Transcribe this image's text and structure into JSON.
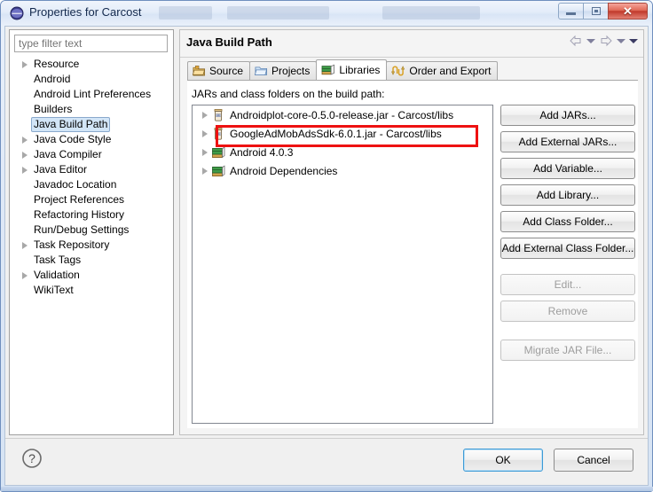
{
  "window": {
    "title": "Properties for Carcost",
    "icon": "eclipse-icon",
    "controls": {
      "minimize": "minimize",
      "restore": "restore",
      "close": "close"
    }
  },
  "sidebar": {
    "filter_placeholder": "type filter text",
    "items": [
      {
        "label": "Resource",
        "expandable": true,
        "selected": false
      },
      {
        "label": "Android",
        "expandable": false,
        "selected": false
      },
      {
        "label": "Android Lint Preferences",
        "expandable": false,
        "selected": false
      },
      {
        "label": "Builders",
        "expandable": false,
        "selected": false
      },
      {
        "label": "Java Build Path",
        "expandable": false,
        "selected": true
      },
      {
        "label": "Java Code Style",
        "expandable": true,
        "selected": false
      },
      {
        "label": "Java Compiler",
        "expandable": true,
        "selected": false
      },
      {
        "label": "Java Editor",
        "expandable": true,
        "selected": false
      },
      {
        "label": "Javadoc Location",
        "expandable": false,
        "selected": false
      },
      {
        "label": "Project References",
        "expandable": false,
        "selected": false
      },
      {
        "label": "Refactoring History",
        "expandable": false,
        "selected": false
      },
      {
        "label": "Run/Debug Settings",
        "expandable": false,
        "selected": false
      },
      {
        "label": "Task Repository",
        "expandable": true,
        "selected": false
      },
      {
        "label": "Task Tags",
        "expandable": false,
        "selected": false
      },
      {
        "label": "Validation",
        "expandable": true,
        "selected": false
      },
      {
        "label": "WikiText",
        "expandable": false,
        "selected": false
      }
    ]
  },
  "page": {
    "title": "Java Build Path",
    "nav": {
      "back": "back-arrow",
      "back_menu": "chevron-down",
      "forward": "forward-arrow",
      "forward_menu": "chevron-down",
      "menu": "chevron-down"
    },
    "tabs": [
      {
        "label": "Source",
        "icon": "source-folder-icon",
        "active": false
      },
      {
        "label": "Projects",
        "icon": "open-folder-icon",
        "active": false
      },
      {
        "label": "Libraries",
        "icon": "libraries-books-icon",
        "active": true
      },
      {
        "label": "Order and Export",
        "icon": "order-export-icon",
        "active": false
      }
    ],
    "list_label": "JARs and class folders on the build path:",
    "entries": [
      {
        "label": "Androidplot-core-0.5.0-release.jar - Carcost/libs",
        "icon": "jar-icon",
        "highlighted": false
      },
      {
        "label": "GoogleAdMobAdsSdk-6.0.1.jar - Carcost/libs",
        "icon": "jar-icon",
        "highlighted": true
      },
      {
        "label": "Android 4.0.3",
        "icon": "library-icon",
        "highlighted": false
      },
      {
        "label": "Android Dependencies",
        "icon": "library-icon",
        "highlighted": false
      }
    ],
    "highlight_color": "#ee1111",
    "buttons": [
      {
        "label": "Add JARs...",
        "enabled": true
      },
      {
        "label": "Add External JARs...",
        "enabled": true
      },
      {
        "label": "Add Variable...",
        "enabled": true
      },
      {
        "label": "Add Library...",
        "enabled": true
      },
      {
        "label": "Add Class Folder...",
        "enabled": true
      },
      {
        "label": "Add External Class Folder...",
        "enabled": true
      },
      {
        "label": "Edit...",
        "enabled": false
      },
      {
        "label": "Remove",
        "enabled": false
      },
      {
        "label": "Migrate JAR File...",
        "enabled": false
      }
    ]
  },
  "footer": {
    "help_icon": "help-question-icon",
    "ok_label": "OK",
    "cancel_label": "Cancel"
  }
}
